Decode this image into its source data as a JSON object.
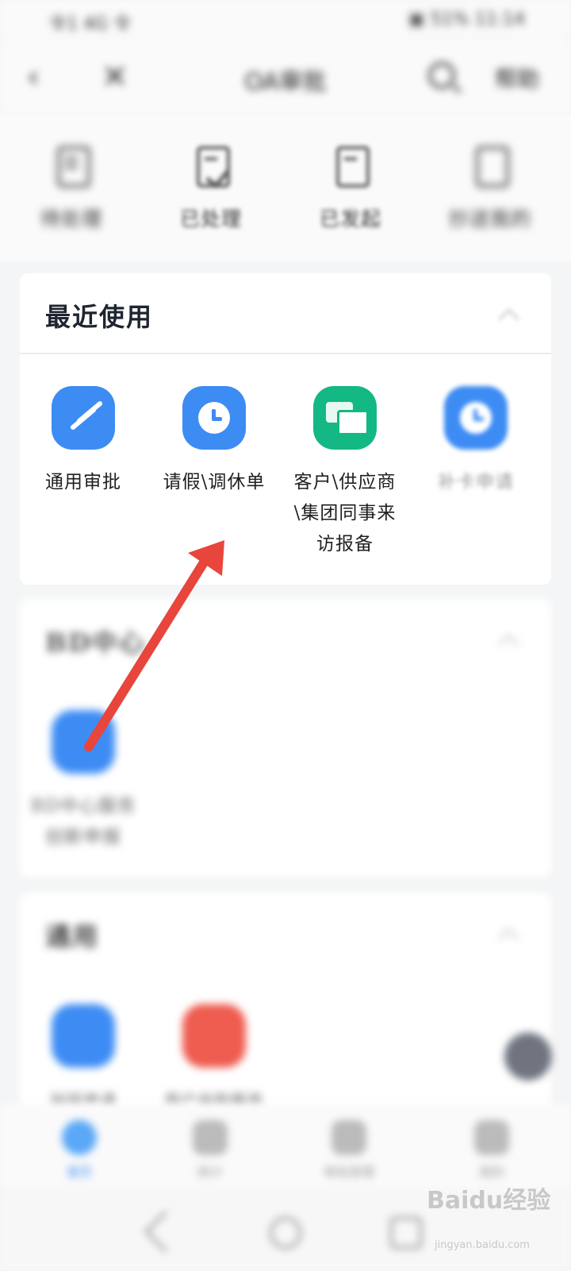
{
  "status_bar": {
    "left": "令1 4G 令",
    "right": "▣ 51% 11:14"
  },
  "header": {
    "back_icon": "chevron-left-icon",
    "close_icon": "close-icon",
    "title": "OA审批",
    "search_icon": "search-icon",
    "more_label": "帮助"
  },
  "top_tabs": [
    {
      "label": "待处理",
      "icon": "pending-doc-icon"
    },
    {
      "label": "已处理",
      "icon": "processed-check-icon"
    },
    {
      "label": "已发起",
      "icon": "initiated-doc-icon"
    },
    {
      "label": "抄送我的",
      "icon": "cc-icon"
    }
  ],
  "recent_section": {
    "title": "最近使用",
    "apps": [
      {
        "label": "通用审批",
        "icon": "stamp-icon",
        "color": "#3d8cf4"
      },
      {
        "label": "请假\\调休单",
        "icon": "clock-icon",
        "color": "#3d8cf4"
      },
      {
        "label": "客户\\供应商\\集团同事来访报备",
        "label_lines": [
          "客户\\供应商",
          "\\集团同事来",
          "访报备"
        ],
        "icon": "chat-icon",
        "color": "#14b884"
      },
      {
        "label": "补卡申请",
        "icon": "clock-icon",
        "color": "#3d8cf4"
      }
    ]
  },
  "bd_section": {
    "title": "BD中心",
    "apps": [
      {
        "label_lines": [
          "BD中心服务",
          "创新申报"
        ],
        "icon": "app-icon",
        "color": "#3d8cf4"
      }
    ]
  },
  "general_section": {
    "title": "通用",
    "apps": [
      {
        "label": "加班申请",
        "icon": "app-icon",
        "color": "#3d8cf4"
      },
      {
        "label": "用户自助服务",
        "icon": "app-icon",
        "color": "#ef5c50"
      }
    ]
  },
  "bottom_nav": [
    {
      "label": "首页",
      "icon": "home-icon",
      "active": true
    },
    {
      "label": "统计",
      "icon": "stats-icon",
      "active": false
    },
    {
      "label": "审批管理",
      "icon": "manage-icon",
      "active": false
    },
    {
      "label": "我的",
      "icon": "profile-icon",
      "active": false
    }
  ],
  "watermark": {
    "text": "Baidu经验",
    "sub": "jingyan.baidu.com"
  },
  "annotation_arrow": {
    "color": "#e8453c"
  }
}
